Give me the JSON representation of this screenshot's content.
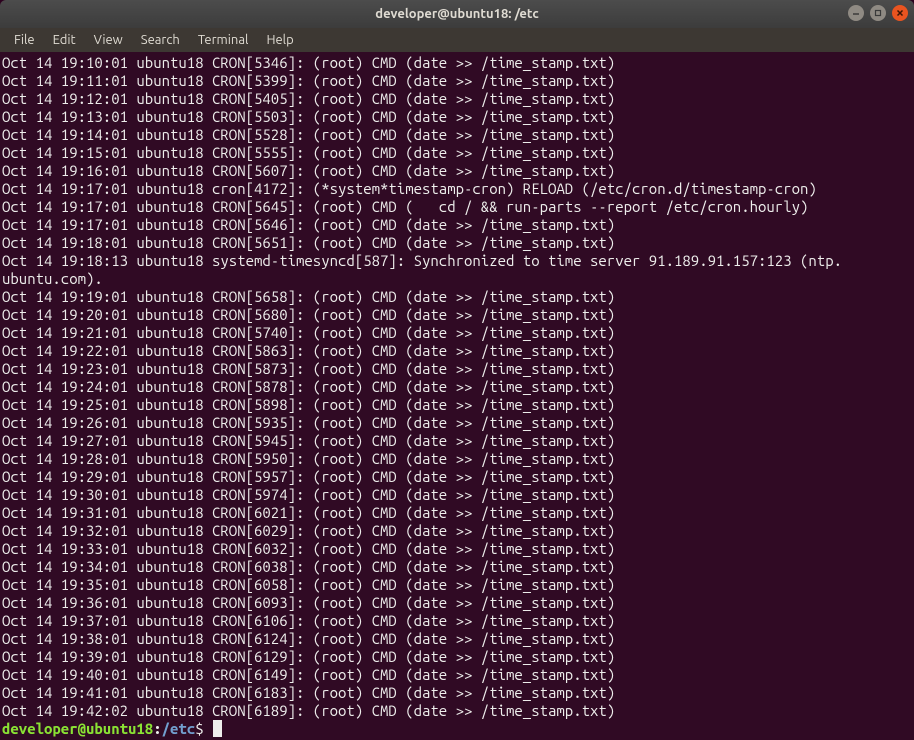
{
  "window": {
    "title": "developer@ubuntu18: /etc"
  },
  "menubar": {
    "items": [
      "File",
      "Edit",
      "View",
      "Search",
      "Terminal",
      "Help"
    ]
  },
  "prompt": {
    "user_host": "developer@ubuntu18",
    "colon": ":",
    "path": "/etc",
    "symbol": "$"
  },
  "log_lines": [
    "Oct 14 19:10:01 ubuntu18 CRON[5346]: (root) CMD (date >> /time_stamp.txt)",
    "Oct 14 19:11:01 ubuntu18 CRON[5399]: (root) CMD (date >> /time_stamp.txt)",
    "Oct 14 19:12:01 ubuntu18 CRON[5405]: (root) CMD (date >> /time_stamp.txt)",
    "Oct 14 19:13:01 ubuntu18 CRON[5503]: (root) CMD (date >> /time_stamp.txt)",
    "Oct 14 19:14:01 ubuntu18 CRON[5528]: (root) CMD (date >> /time_stamp.txt)",
    "Oct 14 19:15:01 ubuntu18 CRON[5555]: (root) CMD (date >> /time_stamp.txt)",
    "Oct 14 19:16:01 ubuntu18 CRON[5607]: (root) CMD (date >> /time_stamp.txt)",
    "Oct 14 19:17:01 ubuntu18 cron[4172]: (*system*timestamp-cron) RELOAD (/etc/cron.d/timestamp-cron)",
    "Oct 14 19:17:01 ubuntu18 CRON[5645]: (root) CMD (   cd / && run-parts --report /etc/cron.hourly)",
    "Oct 14 19:17:01 ubuntu18 CRON[5646]: (root) CMD (date >> /time_stamp.txt)",
    "Oct 14 19:18:01 ubuntu18 CRON[5651]: (root) CMD (date >> /time_stamp.txt)",
    "Oct 14 19:18:13 ubuntu18 systemd-timesyncd[587]: Synchronized to time server 91.189.91.157:123 (ntp.",
    "ubuntu.com).",
    "Oct 14 19:19:01 ubuntu18 CRON[5658]: (root) CMD (date >> /time_stamp.txt)",
    "Oct 14 19:20:01 ubuntu18 CRON[5680]: (root) CMD (date >> /time_stamp.txt)",
    "Oct 14 19:21:01 ubuntu18 CRON[5740]: (root) CMD (date >> /time_stamp.txt)",
    "Oct 14 19:22:01 ubuntu18 CRON[5863]: (root) CMD (date >> /time_stamp.txt)",
    "Oct 14 19:23:01 ubuntu18 CRON[5873]: (root) CMD (date >> /time_stamp.txt)",
    "Oct 14 19:24:01 ubuntu18 CRON[5878]: (root) CMD (date >> /time_stamp.txt)",
    "Oct 14 19:25:01 ubuntu18 CRON[5898]: (root) CMD (date >> /time_stamp.txt)",
    "Oct 14 19:26:01 ubuntu18 CRON[5935]: (root) CMD (date >> /time_stamp.txt)",
    "Oct 14 19:27:01 ubuntu18 CRON[5945]: (root) CMD (date >> /time_stamp.txt)",
    "Oct 14 19:28:01 ubuntu18 CRON[5950]: (root) CMD (date >> /time_stamp.txt)",
    "Oct 14 19:29:01 ubuntu18 CRON[5957]: (root) CMD (date >> /time_stamp.txt)",
    "Oct 14 19:30:01 ubuntu18 CRON[5974]: (root) CMD (date >> /time_stamp.txt)",
    "Oct 14 19:31:01 ubuntu18 CRON[6021]: (root) CMD (date >> /time_stamp.txt)",
    "Oct 14 19:32:01 ubuntu18 CRON[6029]: (root) CMD (date >> /time_stamp.txt)",
    "Oct 14 19:33:01 ubuntu18 CRON[6032]: (root) CMD (date >> /time_stamp.txt)",
    "Oct 14 19:34:01 ubuntu18 CRON[6038]: (root) CMD (date >> /time_stamp.txt)",
    "Oct 14 19:35:01 ubuntu18 CRON[6058]: (root) CMD (date >> /time_stamp.txt)",
    "Oct 14 19:36:01 ubuntu18 CRON[6093]: (root) CMD (date >> /time_stamp.txt)",
    "Oct 14 19:37:01 ubuntu18 CRON[6106]: (root) CMD (date >> /time_stamp.txt)",
    "Oct 14 19:38:01 ubuntu18 CRON[6124]: (root) CMD (date >> /time_stamp.txt)",
    "Oct 14 19:39:01 ubuntu18 CRON[6129]: (root) CMD (date >> /time_stamp.txt)",
    "Oct 14 19:40:01 ubuntu18 CRON[6149]: (root) CMD (date >> /time_stamp.txt)",
    "Oct 14 19:41:01 ubuntu18 CRON[6183]: (root) CMD (date >> /time_stamp.txt)",
    "Oct 14 19:42:02 ubuntu18 CRON[6189]: (root) CMD (date >> /time_stamp.txt)"
  ]
}
